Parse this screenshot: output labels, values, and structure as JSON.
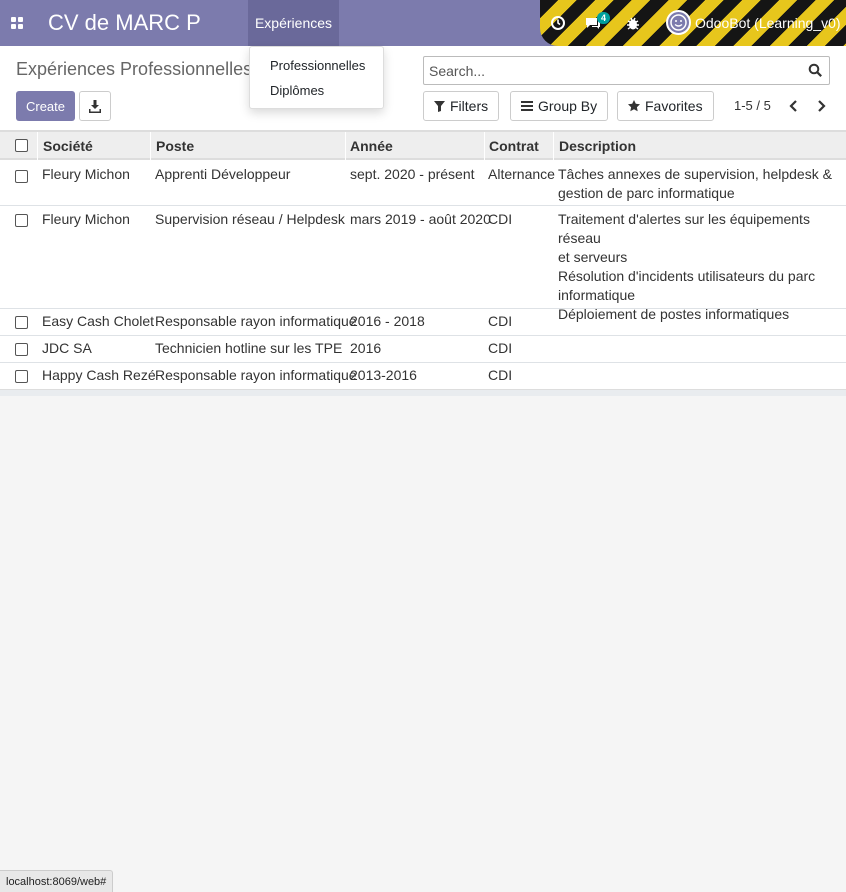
{
  "navbar": {
    "app_title": "CV de MARC P",
    "menu": "Expériences",
    "messages_count": "4",
    "user": "OdooBot (Learning_v0)"
  },
  "dropdown": {
    "items": [
      "Professionnelles",
      "Diplômes"
    ]
  },
  "control_panel": {
    "breadcrumb": "Expériences Professionnelles",
    "create_label": "Create",
    "search_placeholder": "Search...",
    "filters_label": "Filters",
    "group_by_label": "Group By",
    "favorites_label": "Favorites",
    "pager": "1-5 / 5"
  },
  "table": {
    "headers": [
      "Société",
      "Poste",
      "Année",
      "Contrat",
      "Description"
    ],
    "rows": [
      {
        "societe": "Fleury Michon",
        "poste": "Apprenti Développeur",
        "annee": "sept. 2020 - présent",
        "contrat": "Alternance",
        "description": [
          "Tâches annexes de supervision, helpdesk &",
          "gestion de parc informatique"
        ]
      },
      {
        "societe": "Fleury Michon",
        "poste": "Supervision réseau / Helpdesk",
        "annee": "mars 2019 - août 2020",
        "contrat": "CDI",
        "description": [
          "Traitement d'alertes sur les équipements réseau",
          "et serveurs",
          "Résolution d'incidents utilisateurs du parc",
          "informatique",
          "Déploiement de postes informatiques"
        ]
      },
      {
        "societe": "Easy Cash Cholet",
        "poste": "Responsable rayon informatique",
        "annee": "2016 - 2018",
        "contrat": "CDI",
        "description": []
      },
      {
        "societe": "JDC SA",
        "poste": "Technicien hotline sur les TPE",
        "annee": "2016",
        "contrat": "CDI",
        "description": []
      },
      {
        "societe": "Happy Cash Rezé",
        "poste": "Responsable rayon informatique",
        "annee": "2013-2016",
        "contrat": "CDI",
        "description": []
      }
    ]
  },
  "status_bar": "localhost:8069/web#",
  "colors": {
    "primary": "#7c7bad",
    "menu_active": "#6a699a",
    "badge": "#00a09d"
  }
}
